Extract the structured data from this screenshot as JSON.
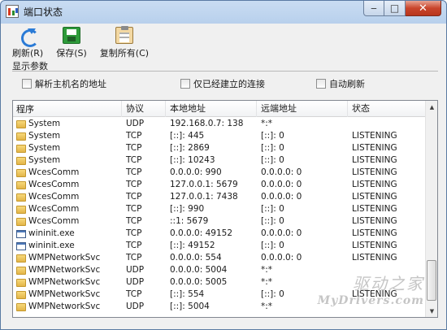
{
  "window": {
    "title": "端口状态"
  },
  "toolbar": {
    "refresh_label": "刷新(R)",
    "save_label": "保存(S)",
    "copy_all_label": "复制所有(C)"
  },
  "options": {
    "group_title": "显示参数",
    "resolve_hostnames": {
      "label": "解析主机名的地址",
      "checked": false
    },
    "established_only": {
      "label": "仅已经建立的连接",
      "checked": false
    },
    "auto_refresh": {
      "label": "自动刷新",
      "checked": false
    }
  },
  "table": {
    "headers": [
      "程序",
      "协议",
      "本地地址",
      "远端地址",
      "状态"
    ],
    "rows": [
      {
        "icon": "folder",
        "program": "System",
        "protocol": "UDP",
        "local": "192.168.0.7: 138",
        "remote": "*:*",
        "state": ""
      },
      {
        "icon": "folder",
        "program": "System",
        "protocol": "TCP",
        "local": "[::]: 445",
        "remote": "[::]: 0",
        "state": "LISTENING"
      },
      {
        "icon": "folder",
        "program": "System",
        "protocol": "TCP",
        "local": "[::]: 2869",
        "remote": "[::]: 0",
        "state": "LISTENING"
      },
      {
        "icon": "folder",
        "program": "System",
        "protocol": "TCP",
        "local": "[::]: 10243",
        "remote": "[::]: 0",
        "state": "LISTENING"
      },
      {
        "icon": "folder",
        "program": "WcesComm",
        "protocol": "TCP",
        "local": "0.0.0.0: 990",
        "remote": "0.0.0.0: 0",
        "state": "LISTENING"
      },
      {
        "icon": "folder",
        "program": "WcesComm",
        "protocol": "TCP",
        "local": "127.0.0.1: 5679",
        "remote": "0.0.0.0: 0",
        "state": "LISTENING"
      },
      {
        "icon": "folder",
        "program": "WcesComm",
        "protocol": "TCP",
        "local": "127.0.0.1: 7438",
        "remote": "0.0.0.0: 0",
        "state": "LISTENING"
      },
      {
        "icon": "folder",
        "program": "WcesComm",
        "protocol": "TCP",
        "local": "[::]: 990",
        "remote": "[::]: 0",
        "state": "LISTENING"
      },
      {
        "icon": "folder",
        "program": "WcesComm",
        "protocol": "TCP",
        "local": "::1: 5679",
        "remote": "[::]: 0",
        "state": "LISTENING"
      },
      {
        "icon": "exe",
        "program": "wininit.exe",
        "protocol": "TCP",
        "local": "0.0.0.0: 49152",
        "remote": "0.0.0.0: 0",
        "state": "LISTENING"
      },
      {
        "icon": "exe",
        "program": "wininit.exe",
        "protocol": "TCP",
        "local": "[::]: 49152",
        "remote": "[::]: 0",
        "state": "LISTENING"
      },
      {
        "icon": "folder",
        "program": "WMPNetworkSvc",
        "protocol": "TCP",
        "local": "0.0.0.0: 554",
        "remote": "0.0.0.0: 0",
        "state": "LISTENING"
      },
      {
        "icon": "folder",
        "program": "WMPNetworkSvc",
        "protocol": "UDP",
        "local": "0.0.0.0: 5004",
        "remote": "*:*",
        "state": ""
      },
      {
        "icon": "folder",
        "program": "WMPNetworkSvc",
        "protocol": "UDP",
        "local": "0.0.0.0: 5005",
        "remote": "*:*",
        "state": ""
      },
      {
        "icon": "folder",
        "program": "WMPNetworkSvc",
        "protocol": "TCP",
        "local": "[::]: 554",
        "remote": "[::]: 0",
        "state": "LISTENING"
      },
      {
        "icon": "folder",
        "program": "WMPNetworkSvc",
        "protocol": "UDP",
        "local": "[::]: 5004",
        "remote": "*:*",
        "state": ""
      }
    ]
  },
  "watermark": {
    "cn": "驱动之家",
    "en": "MyDrivers.com"
  }
}
